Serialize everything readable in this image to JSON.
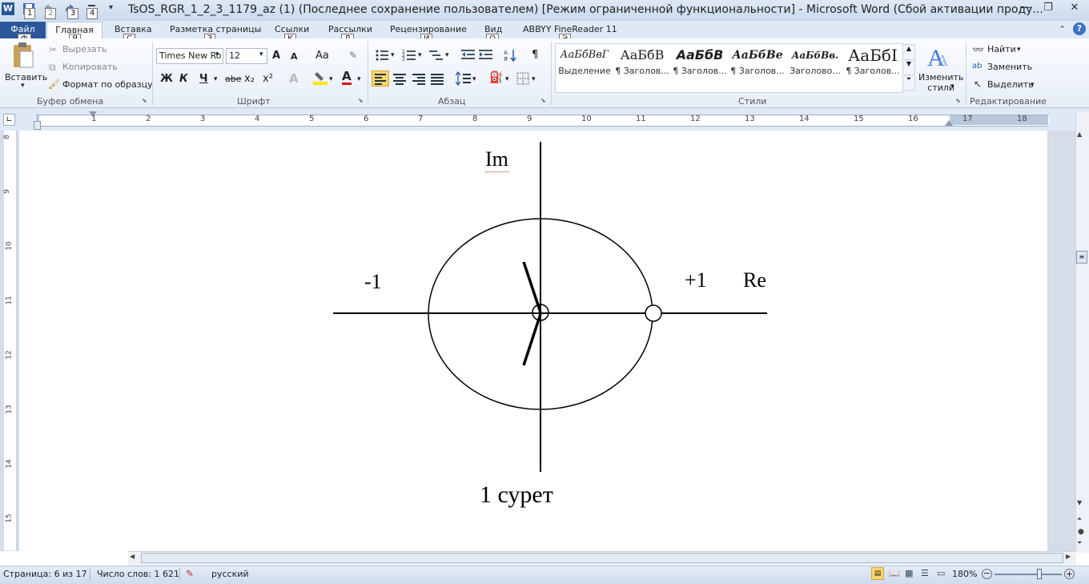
{
  "window": {
    "title": "TsOS_RGR_1_2_3_1179_az (1) (Последнее сохранение пользователем) [Режим ограниченной функциональности]  -  Microsoft Word (Сбой активации проду...",
    "app_icon": "W",
    "qat_keytips": [
      "1",
      "2",
      "3",
      "4"
    ]
  },
  "tabs": {
    "file": "Файл",
    "file_keytip": "Ф",
    "items": [
      {
        "label": "Главная",
        "keytip": "Я"
      },
      {
        "label": "Вставка",
        "keytip": "С"
      },
      {
        "label": "Разметка страницы",
        "keytip": "З"
      },
      {
        "label": "Ссылки",
        "keytip": "К"
      },
      {
        "label": "Рассылки",
        "keytip": "Л"
      },
      {
        "label": "Рецензирование",
        "keytip": "И"
      },
      {
        "label": "Вид",
        "keytip": "О"
      },
      {
        "label": "ABBYY FineReader 11",
        "keytip": "Э"
      }
    ]
  },
  "clipboard": {
    "paste": "Вставить",
    "cut": "Вырезать",
    "copy": "Копировать",
    "format_painter": "Формат по образцу",
    "group": "Буфер обмена"
  },
  "font": {
    "name": "Times New Ro",
    "size": "12",
    "grow": "A",
    "shrink": "A",
    "case": "Aa",
    "bold": "Ж",
    "italic": "К",
    "underline": "Ч",
    "strike": "abe",
    "sub": "x₂",
    "sup": "x²",
    "color_letter": "A",
    "group": "Шрифт"
  },
  "paragraph": {
    "pilcrow": "¶",
    "group": "Абзац"
  },
  "styles": {
    "items": [
      {
        "sample": "АаБбВвГ",
        "name": "Выделение"
      },
      {
        "sample": "АаБбВ",
        "name": "¶ Заголов..."
      },
      {
        "sample": "АаБбВ",
        "name": "¶ Заголов..."
      },
      {
        "sample": "АаБбВе",
        "name": "¶ Заголов..."
      },
      {
        "sample": "АаБбВв.",
        "name": "Заголово..."
      },
      {
        "sample": "АаБбІ",
        "name": "¶ Заголов..."
      }
    ],
    "change_line1": "Изменить",
    "change_line2": "стили",
    "group": "Стили"
  },
  "editing": {
    "find": "Найти",
    "replace": "Заменить",
    "select": "Выделить",
    "group": "Редактирование"
  },
  "ruler": {
    "h_numbers": [
      "1",
      "2",
      "3",
      "4",
      "5",
      "6",
      "7",
      "8",
      "9",
      "10",
      "11",
      "12",
      "13",
      "14",
      "15",
      "16",
      "17",
      "18"
    ],
    "v_numbers": [
      "8",
      "9",
      "10",
      "11",
      "12",
      "13",
      "14",
      "15"
    ]
  },
  "document": {
    "figure_labels": {
      "im": "Im",
      "minus_one": "-1",
      "plus_one": "+1",
      "re": "Re"
    },
    "caption": "1 сурет"
  },
  "status": {
    "page": "Страница: 6 из 17",
    "words": "Число слов: 1 621",
    "language": "русский",
    "zoom": "180%"
  },
  "colors": {
    "file_tab": "#2b579a",
    "ribbon_bg": "#e7eef8",
    "selected_align": "#fbd66e"
  }
}
